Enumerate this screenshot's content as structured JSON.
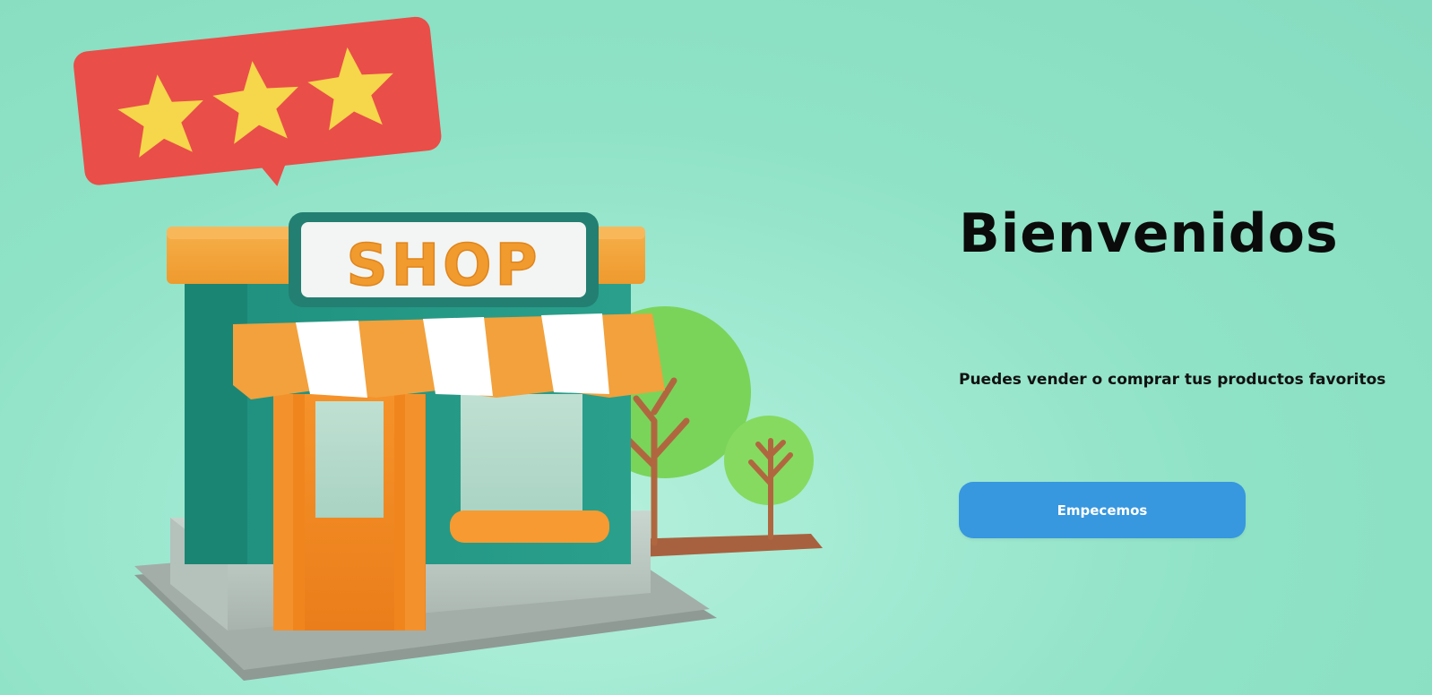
{
  "hero": {
    "title": "Bienvenidos",
    "subtitle": "Puedes vender o comprar tus productos favoritos",
    "cta_label": "Empecemos",
    "accent_color": "#3797df",
    "background_color": "#8fe2c6"
  },
  "illustration": {
    "sign_text": "SHOP",
    "rating_stars": 3,
    "icon": "shop-3d-illustration"
  }
}
